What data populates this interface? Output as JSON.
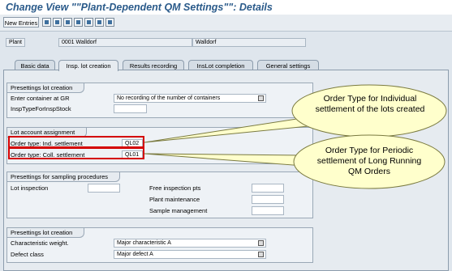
{
  "window": {
    "title": "Change View \"\"Plant-Dependent QM Settings\"\": Details"
  },
  "toolbar": {
    "new_entries_label": "New Entries",
    "icons": [
      "copy-icon",
      "delete-icon",
      "undo-icon",
      "first-page-icon",
      "previous-page-icon",
      "next-page-icon",
      "last-page-icon"
    ]
  },
  "header": {
    "plant_label": "Plant",
    "plant_code": "0001 Walldorf",
    "plant_name": "Walldorf"
  },
  "tabs": [
    {
      "label": "Basic data"
    },
    {
      "label": "Insp. lot creation"
    },
    {
      "label": "Results recording"
    },
    {
      "label": "InsLot completion"
    },
    {
      "label": "General settings"
    }
  ],
  "presettings_lot_creation": {
    "title": "Presettings lot creation",
    "container_label": "Enter container at GR",
    "container_value": "No recording of the number of containers",
    "insp_type_label": "InspTypeForInspStock",
    "insp_type_value": ""
  },
  "lot_account_assignment": {
    "title": "Lot account assignment",
    "ind_label": "Order type: Ind. settlement",
    "ind_value": "QL02",
    "coll_label": "Order type: Coll. settlement",
    "coll_value": "QL01"
  },
  "presettings_sampling": {
    "title": "Presettings for sampling procedures",
    "lot_inspection_label": "Lot inspection",
    "free_insp_label": "Free inspection pts",
    "plant_maint_label": "Plant maintenance",
    "sample_mgmt_label": "Sample management"
  },
  "presettings_lot_creation_2": {
    "title": "Presettings lot creation",
    "char_weight_label": "Characteristic weight.",
    "char_weight_value": "Major characteristic A",
    "defect_class_label": "Defect class",
    "defect_class_value": "Major defect A"
  },
  "callouts": {
    "individual": "Order Type for Individual settlement of the lots created",
    "periodic": "Order Type for Periodic settlement of Long Running QM Orders"
  },
  "colors": {
    "title": "#2a5a8a",
    "callout_fill": "#ffffcc",
    "highlight": "#d40000"
  }
}
